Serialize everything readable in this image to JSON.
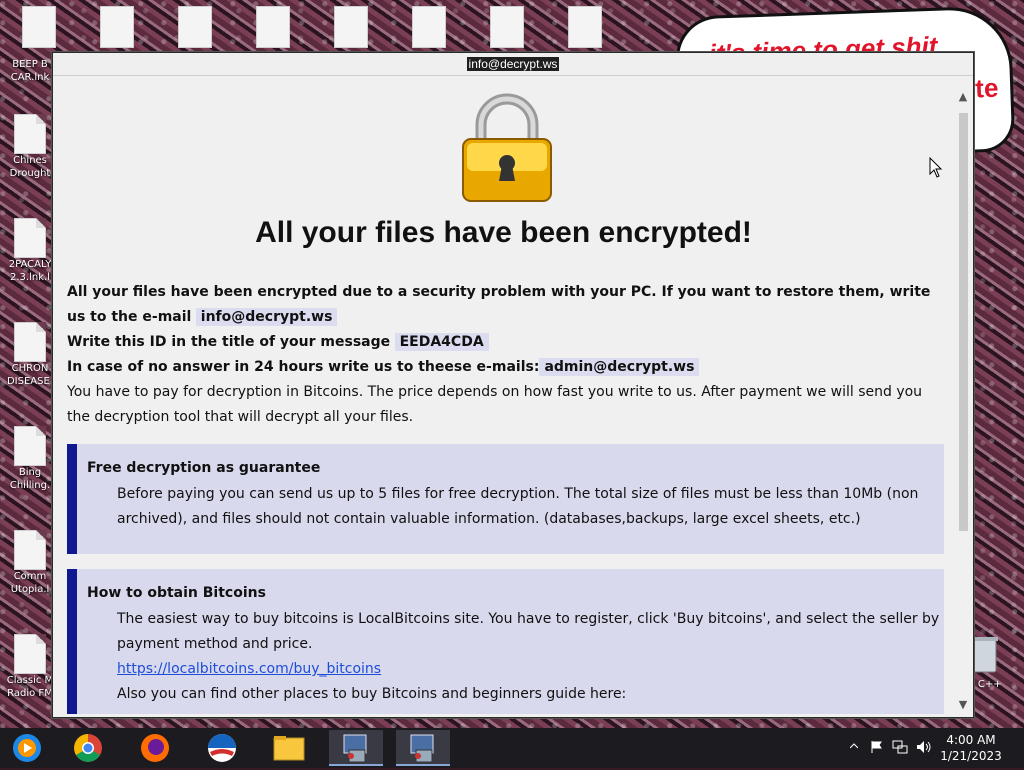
{
  "window": {
    "title": "info@decrypt.ws"
  },
  "note": {
    "heading": "All your files have been encrypted!",
    "line1": "All your files have been encrypted due to a security problem with your PC. If you want to restore them, write us to the e-mail",
    "email": "info@decrypt.ws",
    "line2": "Write this ID in the title of your message",
    "id": "EEDA4CDA",
    "line3": "In case of no answer in 24 hours write us to theese e-mails:",
    "email2": "admin@decrypt.ws",
    "line4": "You have to pay for decryption in Bitcoins. The price depends on how fast you write to us. After payment we will send you the decryption tool that will decrypt all your files."
  },
  "boxes": [
    {
      "title": "Free decryption as guarantee",
      "text": "Before paying you can send us up to 5 files for free decryption. The total size of files must be less than 10Mb (non archived), and files should not contain valuable information. (databases,backups, large excel sheets, etc.)"
    },
    {
      "title": "How to obtain Bitcoins",
      "text": "The easiest way to buy bitcoins is LocalBitcoins site. You have to register, click 'Buy bitcoins', and select the seller by payment method and price.",
      "link": "https://localbitcoins.com/buy_bitcoins",
      "text2": "Also you can find other places to buy Bitcoins and beginners guide here:"
    }
  ],
  "desktop": {
    "icons": [
      {
        "label1": "BEEP B",
        "label2": "CAR.lnk"
      },
      {
        "label1": "Chines",
        "label2": "Drought"
      },
      {
        "label1": "2PACALY",
        "label2": "2.3.lnk.l"
      },
      {
        "label1": "CHRON",
        "label2": "DISEASE."
      },
      {
        "label1": "Bing",
        "label2": "Chilling."
      },
      {
        "label1": "Comm",
        "label2": "Utopia.l"
      },
      {
        "label1": "Classic M",
        "label2": "Radio FM"
      }
    ],
    "wallpaper_text": "it's time to get shit",
    "wallpaper_text2": "te",
    "recycle_label": "n C++"
  },
  "taskbar": {
    "apps": [
      "windows-media-icon",
      "chrome-icon",
      "firefox-icon",
      "obama-logo-icon",
      "file-explorer-icon",
      "installer-icon",
      "installer-icon"
    ],
    "time": "4:00 AM",
    "date": "1/21/2023"
  },
  "colors": {
    "box_bg": "#d9d9ee",
    "box_border": "#0f1890",
    "email_highlight": "#dcdcf0"
  }
}
